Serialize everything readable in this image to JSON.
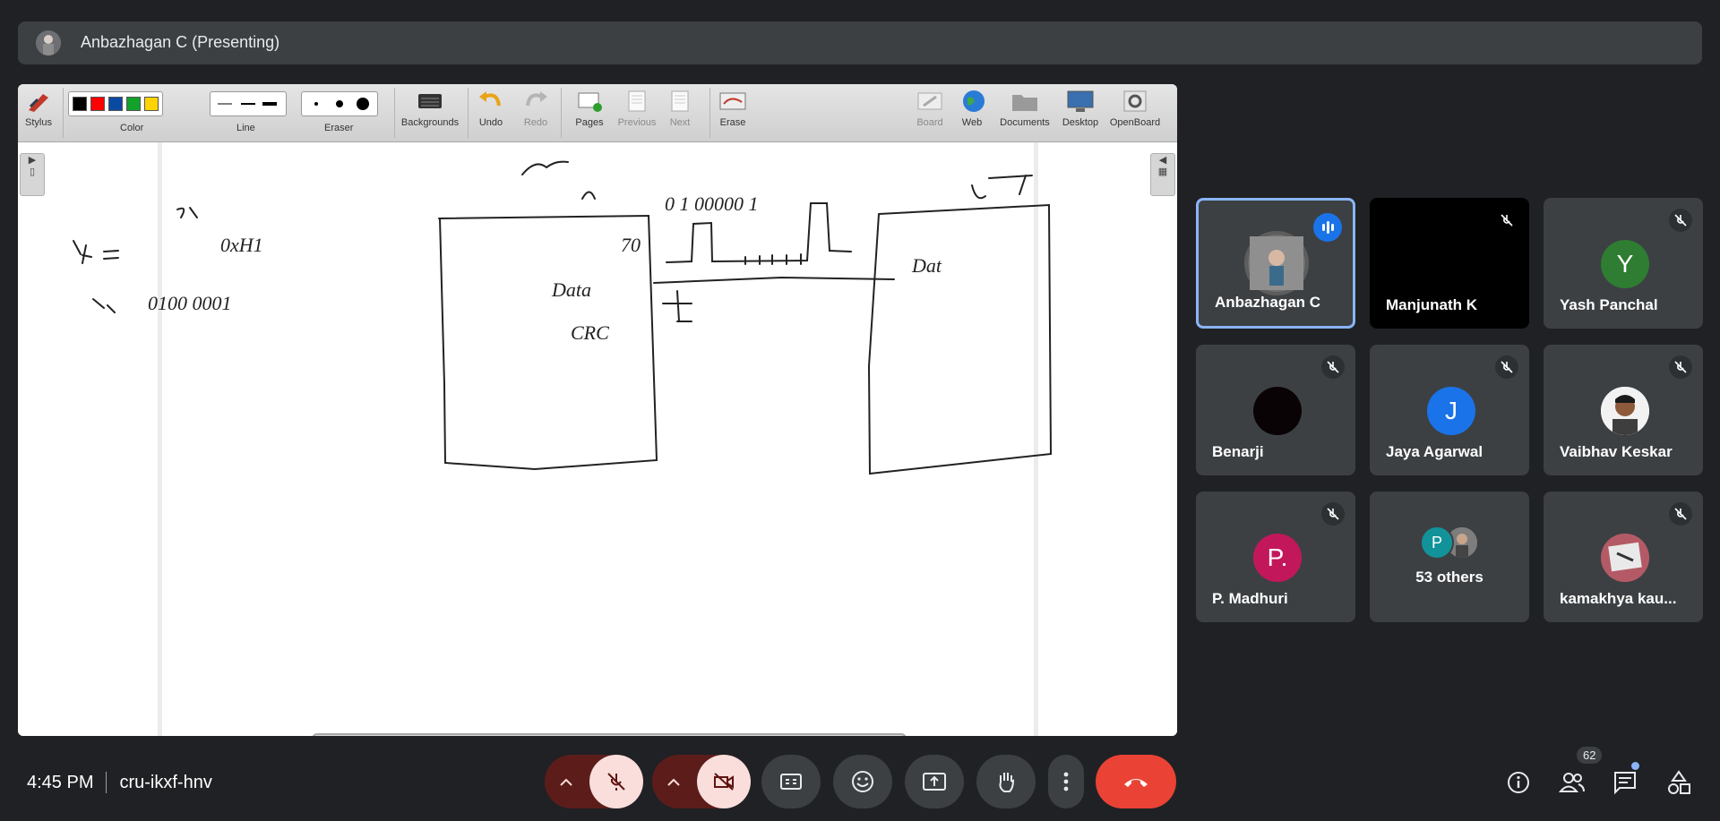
{
  "presenter": {
    "label": "Anbazhagan C (Presenting)"
  },
  "toolbar": {
    "stylus": "Stylus",
    "color": "Color",
    "line": "Line",
    "eraser": "Eraser",
    "backgrounds": "Backgrounds",
    "undo": "Undo",
    "redo": "Redo",
    "pages": "Pages",
    "previous": "Previous",
    "next": "Next",
    "erase": "Erase",
    "board": "Board",
    "web": "Web",
    "documents": "Documents",
    "desktop": "Desktop",
    "openboard": "OpenBoard",
    "colors": [
      "#000000",
      "#ff0000",
      "#0b4aa2",
      "#12a12a",
      "#ffd400"
    ]
  },
  "participants": [
    {
      "name": "Anbazhagan C",
      "speaking": true,
      "avatar_type": "photo"
    },
    {
      "name": "Manjunath K",
      "muted": true,
      "avatar_type": "video-black"
    },
    {
      "name": "Yash Panchal",
      "muted": true,
      "initial": "Y",
      "color": "#2e7d32"
    },
    {
      "name": "Benarji",
      "muted": true,
      "avatar_type": "black-circle"
    },
    {
      "name": "Jaya Agarwal",
      "muted": true,
      "initial": "J",
      "color": "#1a73e8"
    },
    {
      "name": "Vaibhav Keskar",
      "muted": true,
      "avatar_type": "photo"
    },
    {
      "name": "P. Madhuri",
      "muted": true,
      "initial": "P.",
      "color": "#c2185b"
    },
    {
      "name": "53 others",
      "group": true,
      "initial": "P",
      "color": "#12939a"
    },
    {
      "name": "kamakhya kau...",
      "muted": true,
      "avatar_type": "photo"
    }
  ],
  "bottom": {
    "time": "4:45 PM",
    "meeting_code": "cru-ikxf-hnv",
    "people_count": "62"
  },
  "icons": {
    "mic": "mic-off-icon",
    "camera": "camera-off-icon",
    "captions": "captions-icon",
    "emoji": "emoji-icon",
    "present": "present-icon",
    "hand": "raise-hand-icon",
    "more": "more-vert-icon",
    "end": "call-end-icon",
    "info": "info-icon",
    "people": "people-icon",
    "chat": "chat-icon",
    "activities": "activities-icon"
  }
}
